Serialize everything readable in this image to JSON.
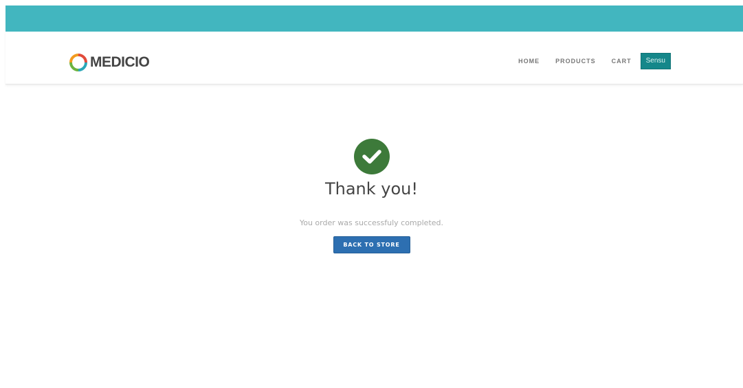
{
  "brand": {
    "name": "MEDICIO",
    "logo_icon": "ring-logo-icon",
    "logo_colors": [
      "#f29b20",
      "#e24b3b",
      "#6cb33f",
      "#2aa7b8"
    ]
  },
  "header": {
    "accent_color": "#42b6bf"
  },
  "nav": {
    "items": [
      {
        "label": "HOME"
      },
      {
        "label": "PRODUCTS"
      },
      {
        "label": "CART"
      }
    ],
    "user_label": "Sensu",
    "user_color": "#15878a"
  },
  "confirmation": {
    "icon": "check-circle-icon",
    "icon_color": "#3d7a3a",
    "title": "Thank you!",
    "message": "You order was successfuly completed.",
    "button_label": "BACK TO STORE",
    "button_color": "#2d6fb1"
  }
}
